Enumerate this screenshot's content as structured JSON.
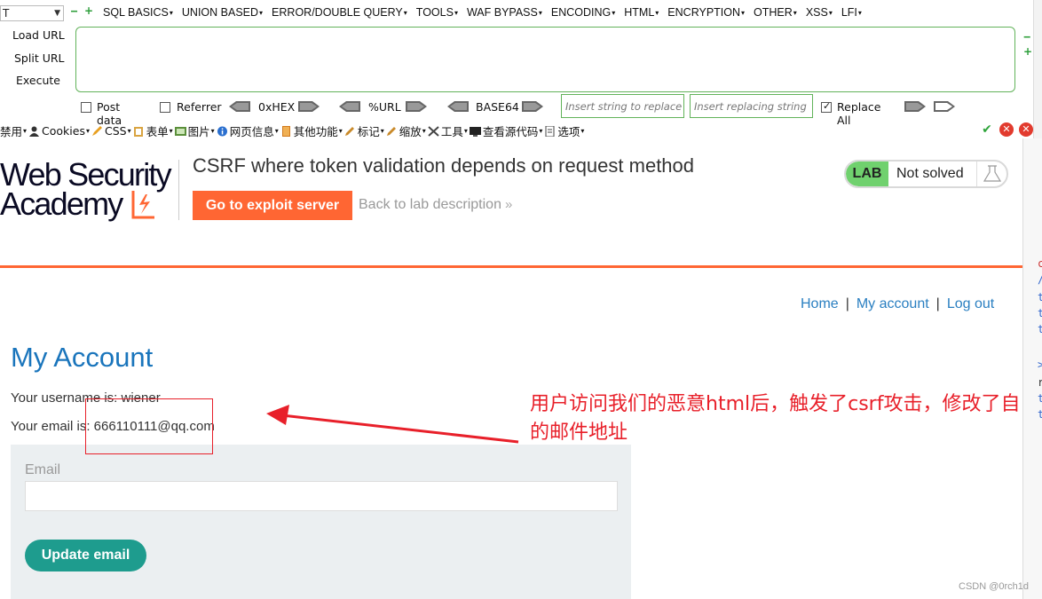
{
  "hackbar": {
    "select_value": "T",
    "menu": [
      "SQL BASICS",
      "UNION BASED",
      "ERROR/DOUBLE QUERY",
      "TOOLS",
      "WAF BYPASS",
      "ENCODING",
      "HTML",
      "ENCRYPTION",
      "OTHER",
      "XSS",
      "LFI"
    ],
    "load_url": "Load URL",
    "split_url": "Split URL",
    "execute": "Execute",
    "url_value": "",
    "post_data": "Post data",
    "referrer": "Referrer",
    "hex": "0xHEX",
    "url_enc": "%URL",
    "base64": "BASE64",
    "replace_placeholder": "Insert string to replace",
    "replacing_placeholder": "Insert replacing string",
    "replace_all": "Replace All",
    "replace_all_checked": true,
    "accent": "#62b35a"
  },
  "devbar": {
    "items": [
      "禁用",
      "Cookies",
      "CSS",
      "表单",
      "图片",
      "网页信息",
      "其他功能",
      "标记",
      "缩放",
      "工具",
      "查看源代码",
      "选项"
    ]
  },
  "lab": {
    "logo_line1": "Web Security",
    "logo_line2": "Academy",
    "title": "CSRF where token validation depends on request method",
    "exploit_button": "Go to exploit server",
    "back_link": "Back to lab description",
    "badge": "LAB",
    "status": "Not solved",
    "accent": "#ff6633"
  },
  "nav": {
    "home": "Home",
    "account": "My account",
    "logout": "Log out",
    "sep": "|"
  },
  "account": {
    "title": "My Account",
    "username_line": "Your username is: wiener",
    "email_line": "Your email is: 666110111@qq.com",
    "email_label": "Email",
    "email_value": "",
    "update_button": "Update email"
  },
  "annotation": {
    "text": "用户访问我们的恶意html后，触发了csrf攻击，修改了自己的邮件地址",
    "color": "#e8202a"
  },
  "watermark": "CSDN @0rch1d"
}
